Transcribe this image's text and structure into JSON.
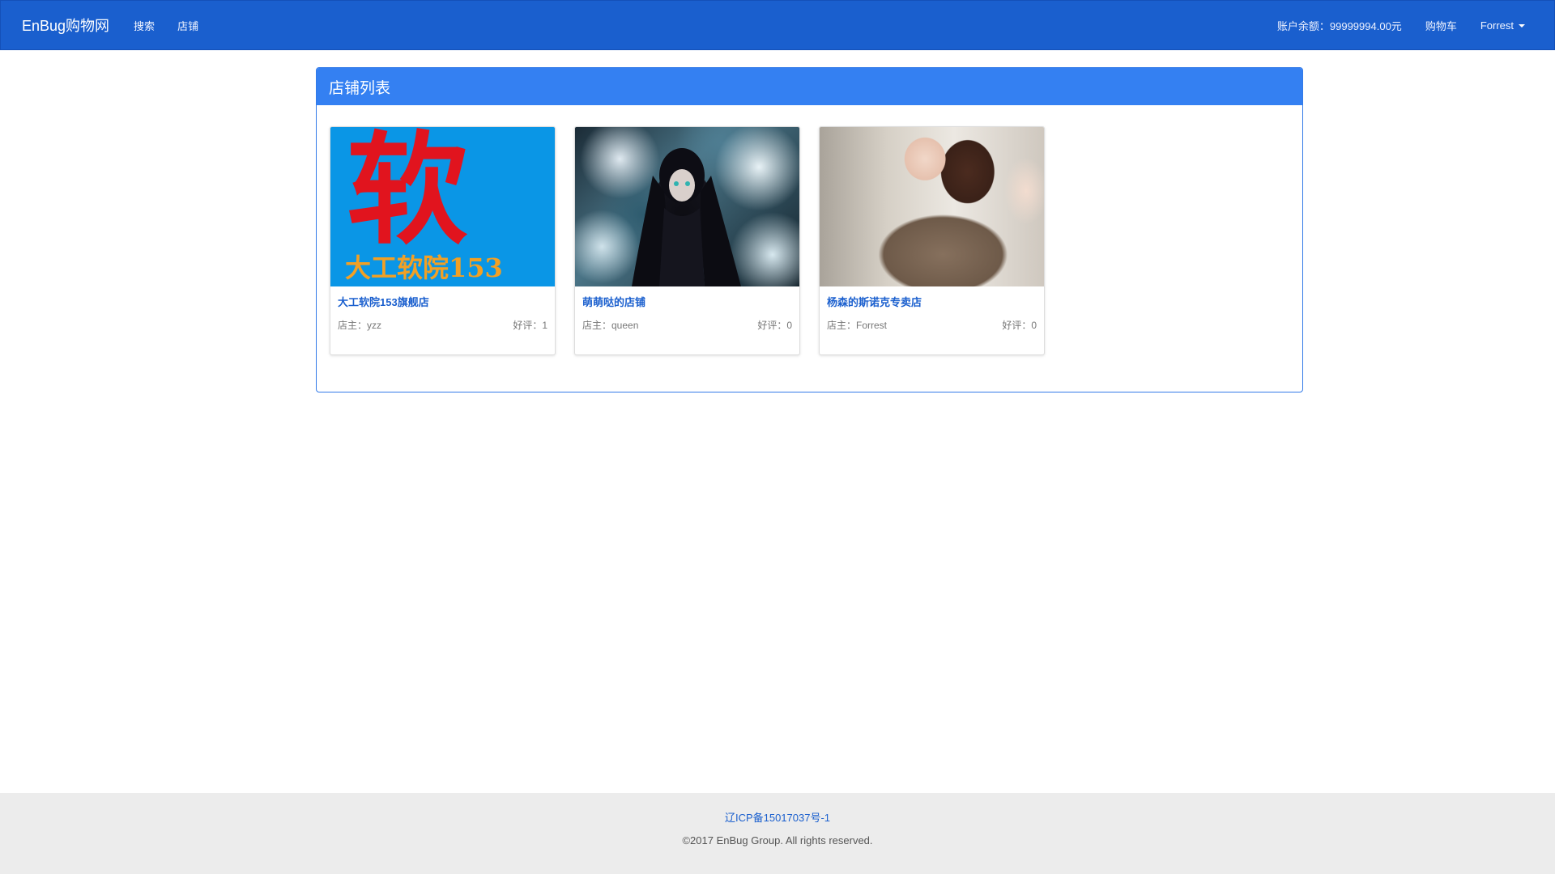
{
  "navbar": {
    "brand": "EnBug购物网",
    "links": [
      {
        "label": "搜索"
      },
      {
        "label": "店铺"
      }
    ],
    "balance": "账户余额：99999994.00元",
    "cart": "购物车",
    "user": "Forrest"
  },
  "panel": {
    "title": "店铺列表",
    "shops": [
      {
        "name": "大工软院153旗舰店",
        "owner": "店主：yzz",
        "rating": "好评：1",
        "image": "logo-image",
        "logo_text": {
          "big": "软",
          "small": "大工软院153"
        }
      },
      {
        "name": "萌萌哒的店铺",
        "owner": "店主：queen",
        "rating": "好评：0",
        "image": "anime-image"
      },
      {
        "name": "杨森的斯诺克专卖店",
        "owner": "店主：Forrest",
        "rating": "好评：0",
        "image": "portrait-image"
      }
    ]
  },
  "footer": {
    "icp": "辽ICP备15017037号-1",
    "copyright": "©2017 EnBug Group. All rights reserved."
  },
  "colors": {
    "navbar": "#1a5fce",
    "panel_heading": "#3480f2",
    "link": "#1a5fce",
    "footer_bg": "#ececec"
  }
}
